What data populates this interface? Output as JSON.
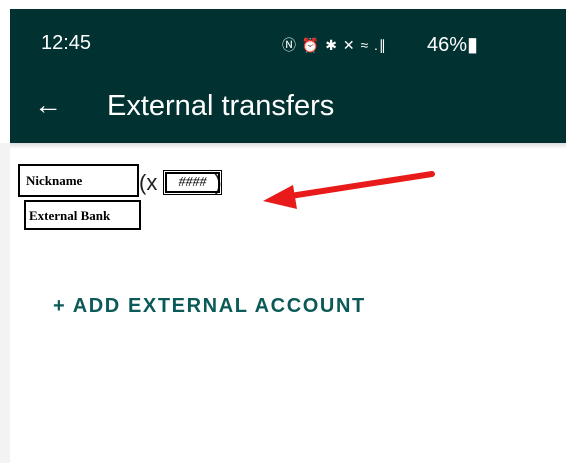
{
  "status_bar": {
    "time": "12:45",
    "icons": "Ⓝ ⏰ ✱ ✕ ≈ .∥",
    "battery": "46%▮"
  },
  "header": {
    "title": "External transfers",
    "back_icon": "arrow-left-icon"
  },
  "account": {
    "nickname": "Nickname",
    "suffix_open": "(x",
    "mask": "####",
    "suffix_close": ")",
    "bank": "External Bank"
  },
  "add_account_label": "+ ADD EXTERNAL ACCOUNT",
  "colors": {
    "header_bg": "#023131",
    "accent": "#0b5a57",
    "annotation_arrow": "#e81a1a"
  }
}
